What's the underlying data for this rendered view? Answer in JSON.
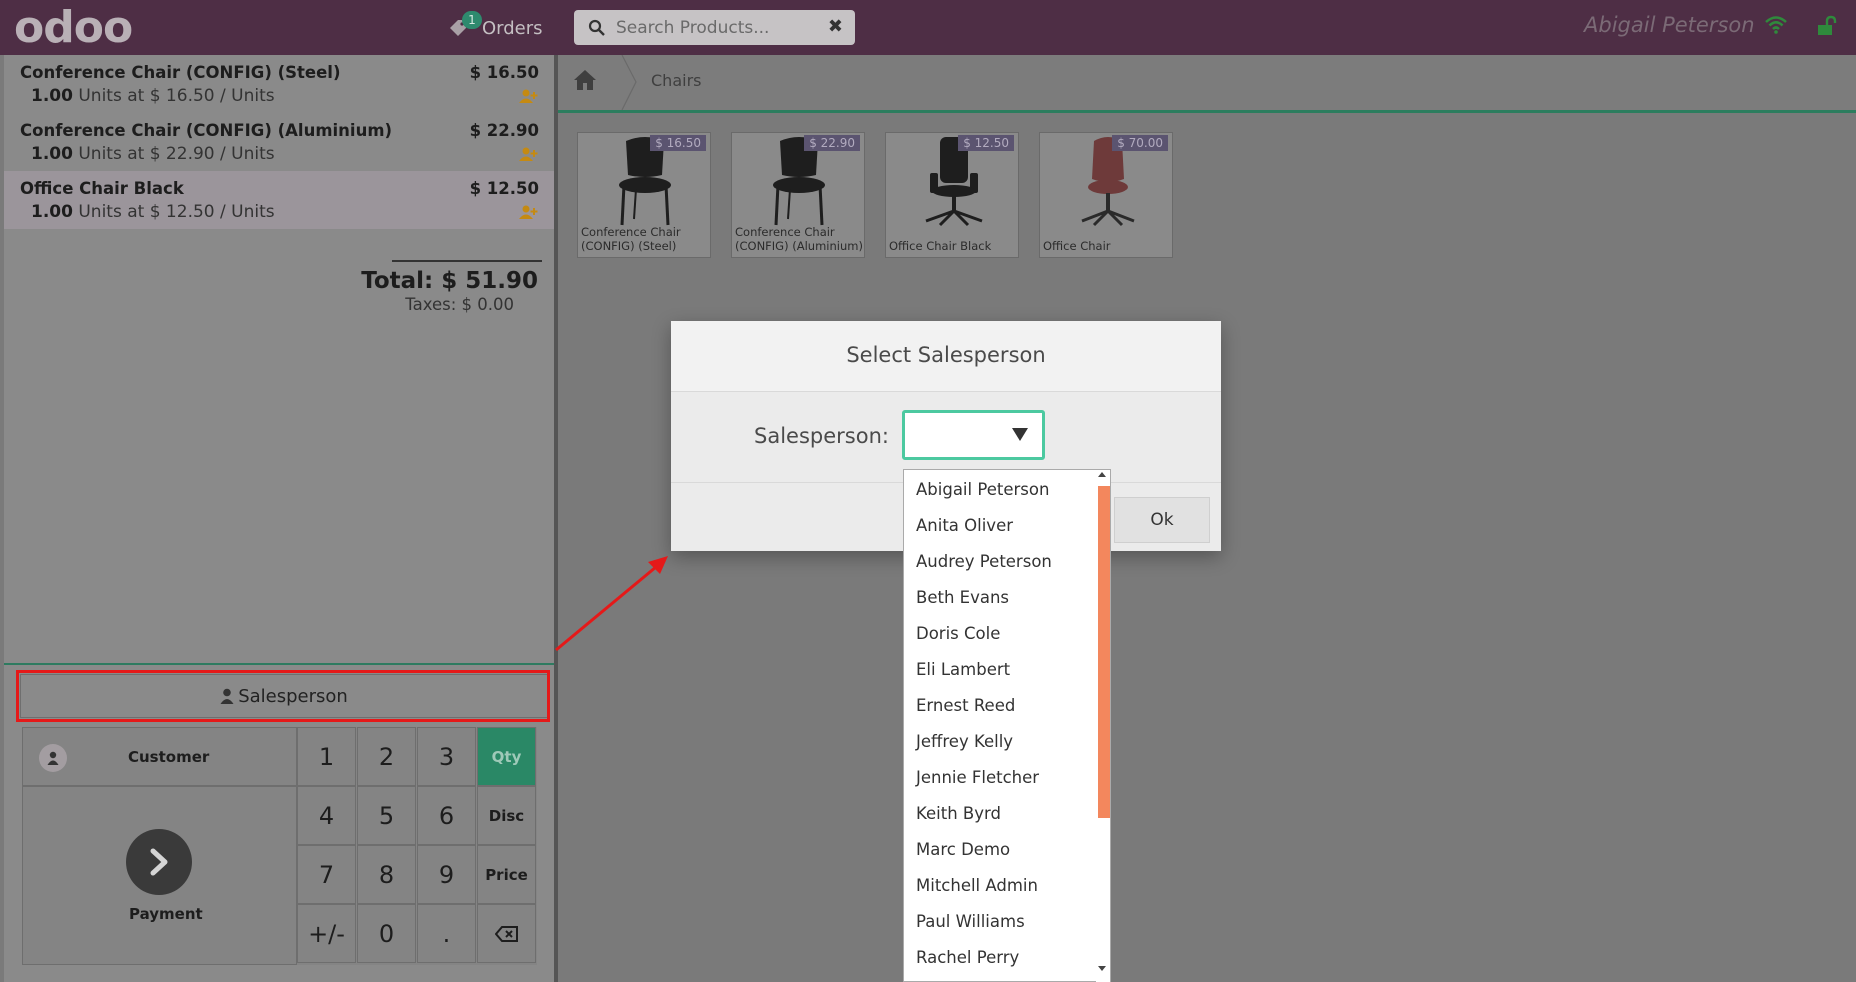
{
  "topbar": {
    "logo": "odoo",
    "orders_label": "Orders",
    "orders_count": "1",
    "search_placeholder": "Search Products...",
    "user_name": "Abigail Peterson"
  },
  "order_lines": [
    {
      "name": "Conference Chair (CONFIG) (Steel)",
      "price": "$ 16.50",
      "qty": "1.00",
      "info": "Units at $ 16.50 / Units"
    },
    {
      "name": "Conference Chair (CONFIG) (Aluminium)",
      "price": "$ 22.90",
      "qty": "1.00",
      "info": "Units at $ 22.90 / Units"
    },
    {
      "name": "Office Chair Black",
      "price": "$ 12.50",
      "qty": "1.00",
      "info": "Units at $ 12.50 / Units"
    }
  ],
  "summary": {
    "total": "Total: $ 51.90",
    "taxes": "Taxes: $ 0.00"
  },
  "salesperson_button": "Salesperson",
  "numpad": {
    "customer": "Customer",
    "payment": "Payment",
    "keys": [
      "1",
      "2",
      "3",
      "Qty",
      "4",
      "5",
      "6",
      "Disc",
      "7",
      "8",
      "9",
      "Price",
      "+/-",
      "0",
      "."
    ]
  },
  "breadcrumb": {
    "category": "Chairs"
  },
  "products": [
    {
      "price": "$ 16.50",
      "name": "Conference Chair (CONFIG) (Steel)"
    },
    {
      "price": "$ 22.90",
      "name": "Conference Chair (CONFIG) (Aluminium)"
    },
    {
      "price": "$ 12.50",
      "name": "Office Chair Black"
    },
    {
      "price": "$ 70.00",
      "name": "Office Chair"
    }
  ],
  "modal": {
    "title": "Select Salesperson",
    "field_label": "Salesperson:",
    "ok_label": "Ok",
    "options": [
      "Abigail Peterson",
      "Anita Oliver",
      "Audrey Peterson",
      "Beth Evans",
      "Doris Cole",
      "Eli Lambert",
      "Ernest Reed",
      "Jeffrey Kelly",
      "Jennie Fletcher",
      "Keith Byrd",
      "Marc Demo",
      "Mitchell Admin",
      "Paul Williams",
      "Rachel Perry"
    ]
  },
  "colors": {
    "topbar": "#4e2e45",
    "accent": "#2a8866",
    "highlight": "#e51919",
    "scroll_thumb": "#f3875d"
  }
}
